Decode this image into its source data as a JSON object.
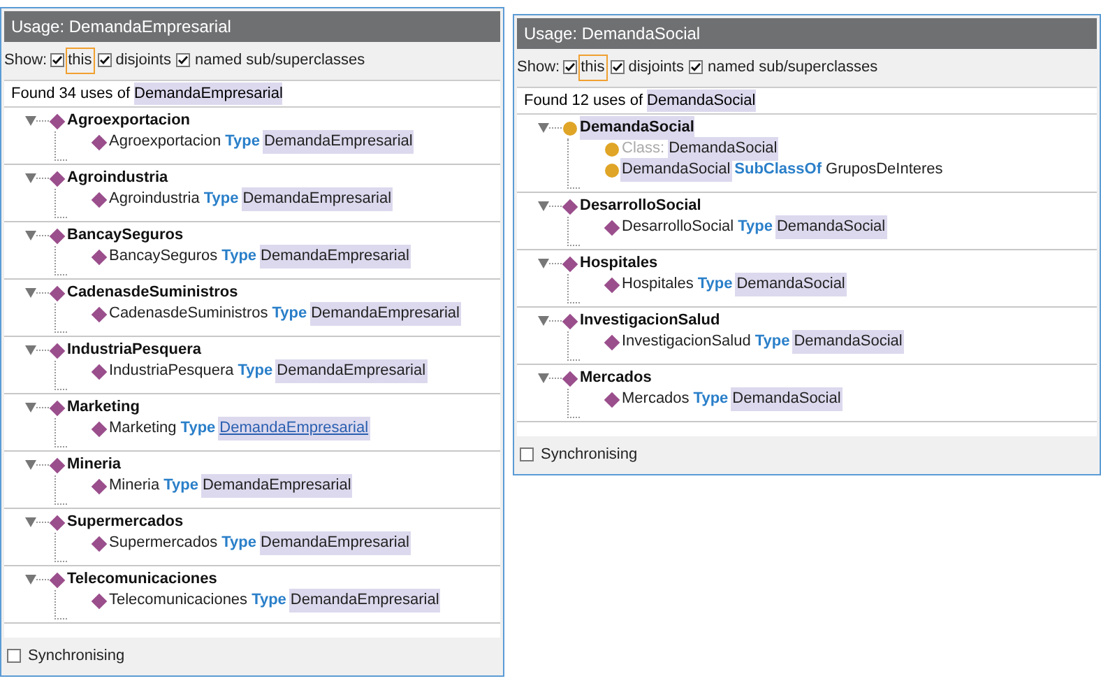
{
  "panels": [
    {
      "title": "Usage: DemandaEmpresarial",
      "show_label": "Show:",
      "show_options": [
        {
          "label": "this",
          "checked": true,
          "focused": true
        },
        {
          "label": "disjoints",
          "checked": true,
          "focused": false
        },
        {
          "label": "named sub/superclasses",
          "checked": true,
          "focused": false
        }
      ],
      "found_prefix": "Found 34 uses of",
      "found_target": "DemandaEmpresarial",
      "groups": [
        {
          "label": "Agroexportacion",
          "kind": "individual",
          "expanded": true,
          "highlighted": false,
          "children": [
            {
              "kind": "individual",
              "parts": [
                {
                  "text": "Agroexportacion",
                  "kind": "plain"
                },
                {
                  "text": "Type",
                  "kind": "keyword"
                },
                {
                  "text": "DemandaEmpresarial",
                  "kind": "highlight"
                }
              ]
            }
          ]
        },
        {
          "label": "Agroindustria",
          "kind": "individual",
          "expanded": true,
          "highlighted": false,
          "children": [
            {
              "kind": "individual",
              "parts": [
                {
                  "text": "Agroindustria",
                  "kind": "plain"
                },
                {
                  "text": "Type",
                  "kind": "keyword"
                },
                {
                  "text": "DemandaEmpresarial",
                  "kind": "highlight"
                }
              ]
            }
          ]
        },
        {
          "label": "BancaySeguros",
          "kind": "individual",
          "expanded": true,
          "highlighted": false,
          "children": [
            {
              "kind": "individual",
              "parts": [
                {
                  "text": "BancaySeguros",
                  "kind": "plain"
                },
                {
                  "text": "Type",
                  "kind": "keyword"
                },
                {
                  "text": "DemandaEmpresarial",
                  "kind": "highlight"
                }
              ]
            }
          ]
        },
        {
          "label": "CadenasdeSuministros",
          "kind": "individual",
          "expanded": true,
          "highlighted": false,
          "children": [
            {
              "kind": "individual",
              "parts": [
                {
                  "text": "CadenasdeSuministros",
                  "kind": "plain"
                },
                {
                  "text": "Type",
                  "kind": "keyword"
                },
                {
                  "text": "DemandaEmpresarial",
                  "kind": "highlight"
                }
              ]
            }
          ]
        },
        {
          "label": "IndustriaPesquera",
          "kind": "individual",
          "expanded": true,
          "highlighted": false,
          "children": [
            {
              "kind": "individual",
              "parts": [
                {
                  "text": "IndustriaPesquera",
                  "kind": "plain"
                },
                {
                  "text": "Type",
                  "kind": "keyword"
                },
                {
                  "text": "DemandaEmpresarial",
                  "kind": "highlight"
                }
              ]
            }
          ]
        },
        {
          "label": "Marketing",
          "kind": "individual",
          "expanded": true,
          "highlighted": false,
          "children": [
            {
              "kind": "individual",
              "parts": [
                {
                  "text": "Marketing",
                  "kind": "plain"
                },
                {
                  "text": "Type",
                  "kind": "keyword"
                },
                {
                  "text": "DemandaEmpresarial",
                  "kind": "link"
                }
              ]
            }
          ]
        },
        {
          "label": "Mineria",
          "kind": "individual",
          "expanded": true,
          "highlighted": false,
          "children": [
            {
              "kind": "individual",
              "parts": [
                {
                  "text": "Mineria",
                  "kind": "plain"
                },
                {
                  "text": "Type",
                  "kind": "keyword"
                },
                {
                  "text": "DemandaEmpresarial",
                  "kind": "highlight"
                }
              ]
            }
          ]
        },
        {
          "label": "Supermercados",
          "kind": "individual",
          "expanded": true,
          "highlighted": false,
          "children": [
            {
              "kind": "individual",
              "parts": [
                {
                  "text": "Supermercados",
                  "kind": "plain"
                },
                {
                  "text": "Type",
                  "kind": "keyword"
                },
                {
                  "text": "DemandaEmpresarial",
                  "kind": "highlight"
                }
              ]
            }
          ]
        },
        {
          "label": "Telecomunicaciones",
          "kind": "individual",
          "expanded": true,
          "highlighted": false,
          "children": [
            {
              "kind": "individual",
              "parts": [
                {
                  "text": "Telecomunicaciones",
                  "kind": "plain"
                },
                {
                  "text": "Type",
                  "kind": "keyword"
                },
                {
                  "text": "DemandaEmpresarial",
                  "kind": "highlight"
                }
              ]
            }
          ]
        }
      ],
      "sync": {
        "label": "Synchronising",
        "checked": false
      }
    },
    {
      "title": "Usage: DemandaSocial",
      "show_label": "Show:",
      "show_options": [
        {
          "label": "this",
          "checked": true,
          "focused": true
        },
        {
          "label": "disjoints",
          "checked": true,
          "focused": false
        },
        {
          "label": "named sub/superclasses",
          "checked": true,
          "focused": false
        }
      ],
      "found_prefix": "Found 12 uses of",
      "found_target": "DemandaSocial",
      "groups": [
        {
          "label": "DemandaSocial",
          "kind": "class",
          "expanded": true,
          "highlighted": true,
          "children": [
            {
              "kind": "class",
              "parts": [
                {
                  "text": "Class:",
                  "kind": "muted"
                },
                {
                  "text": "DemandaSocial",
                  "kind": "highlight"
                }
              ]
            },
            {
              "kind": "class",
              "parts": [
                {
                  "text": "DemandaSocial",
                  "kind": "highlight"
                },
                {
                  "text": "SubClassOf",
                  "kind": "keyword"
                },
                {
                  "text": "GruposDeInteres",
                  "kind": "plain"
                }
              ]
            }
          ]
        },
        {
          "label": "DesarrolloSocial",
          "kind": "individual",
          "expanded": true,
          "highlighted": false,
          "children": [
            {
              "kind": "individual",
              "parts": [
                {
                  "text": "DesarrolloSocial",
                  "kind": "plain"
                },
                {
                  "text": "Type",
                  "kind": "keyword"
                },
                {
                  "text": "DemandaSocial",
                  "kind": "highlight"
                }
              ]
            }
          ]
        },
        {
          "label": "Hospitales",
          "kind": "individual",
          "expanded": true,
          "highlighted": false,
          "children": [
            {
              "kind": "individual",
              "parts": [
                {
                  "text": "Hospitales",
                  "kind": "plain"
                },
                {
                  "text": "Type",
                  "kind": "keyword"
                },
                {
                  "text": "DemandaSocial",
                  "kind": "highlight"
                }
              ]
            }
          ]
        },
        {
          "label": "InvestigacionSalud",
          "kind": "individual",
          "expanded": true,
          "highlighted": false,
          "children": [
            {
              "kind": "individual",
              "parts": [
                {
                  "text": "InvestigacionSalud",
                  "kind": "plain"
                },
                {
                  "text": "Type",
                  "kind": "keyword"
                },
                {
                  "text": "DemandaSocial",
                  "kind": "highlight"
                }
              ]
            }
          ]
        },
        {
          "label": "Mercados",
          "kind": "individual",
          "expanded": true,
          "highlighted": false,
          "children": [
            {
              "kind": "individual",
              "parts": [
                {
                  "text": "Mercados",
                  "kind": "plain"
                },
                {
                  "text": "Type",
                  "kind": "keyword"
                },
                {
                  "text": "DemandaSocial",
                  "kind": "highlight"
                }
              ]
            }
          ]
        }
      ],
      "sync": {
        "label": "Synchronising",
        "checked": false
      }
    }
  ]
}
